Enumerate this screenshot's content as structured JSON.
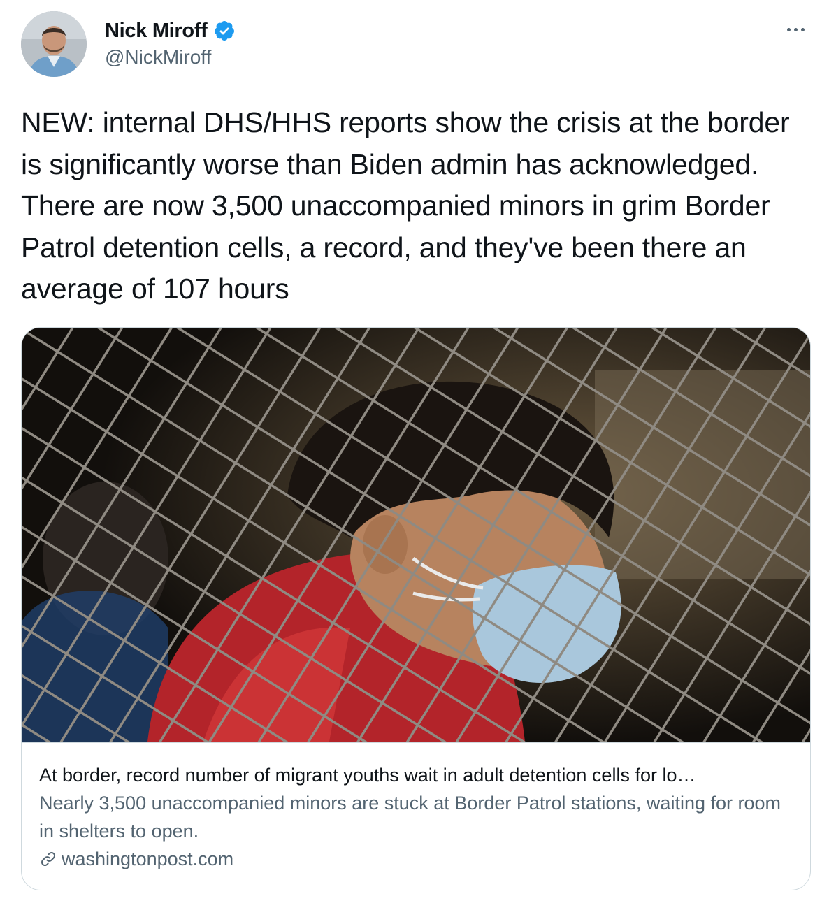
{
  "author": {
    "display_name": "Nick Miroff",
    "handle": "@NickMiroff",
    "verified": true
  },
  "tweet": {
    "text": "NEW: internal DHS/HHS reports show the crisis at the border is significantly worse than Biden admin has acknowledged. There are now 3,500 unaccompanied minors in grim Border Patrol detention cells, a record, and they've been there an average of 107 hours"
  },
  "card": {
    "title": "At border, record number of migrant youths wait in adult detention cells for lo…",
    "description": "Nearly 3,500 unaccompanied minors are stuck at Border Patrol stations, waiting for room in shelters to open.",
    "domain": "washingtonpost.com"
  },
  "icons": {
    "verified": "verified-badge-icon",
    "more": "more-dots-icon",
    "link": "link-icon"
  },
  "colors": {
    "verified_blue": "#1d9bf0",
    "secondary_text": "#536471",
    "primary_text": "#0f1419",
    "border": "#cfd9de"
  }
}
